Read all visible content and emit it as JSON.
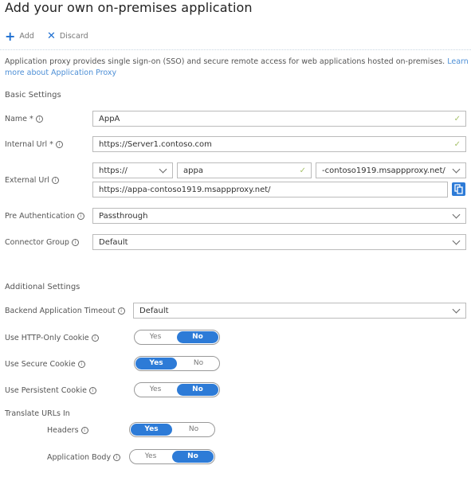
{
  "page": {
    "title": "Add your own on-premises application"
  },
  "toolbar": {
    "add_label": "Add",
    "discard_label": "Discard",
    "add_icon": "plus-icon",
    "discard_icon": "x-icon"
  },
  "description": {
    "text": "Application proxy provides single sign-on (SSO) and secure remote access for web applications hosted on-premises. ",
    "link_text": "Learn more about Application Proxy"
  },
  "basic_settings": {
    "heading": "Basic Settings",
    "name": {
      "label": "Name *",
      "value": "AppA",
      "valid": true
    },
    "internal_url": {
      "label": "Internal Url *",
      "value": "https://Server1.contoso.com",
      "valid": true
    },
    "external_url": {
      "label": "External Url",
      "scheme": "https://",
      "subdomain": "appa",
      "subdomain_valid": true,
      "domain": "-contoso1919.msappproxy.net/",
      "full_url": "https://appa-contoso1919.msappproxy.net/",
      "copy_icon": "copy-icon"
    },
    "pre_authentication": {
      "label": "Pre Authentication",
      "value": "Passthrough"
    },
    "connector_group": {
      "label": "Connector Group",
      "value": "Default"
    }
  },
  "additional_settings": {
    "heading": "Additional Settings",
    "backend_timeout": {
      "label": "Backend Application Timeout",
      "value": "Default"
    },
    "http_only_cookie": {
      "label": "Use HTTP-Only Cookie",
      "yes": "Yes",
      "no": "No",
      "selected": "No"
    },
    "secure_cookie": {
      "label": "Use Secure Cookie",
      "yes": "Yes",
      "no": "No",
      "selected": "Yes"
    },
    "persistent_cookie": {
      "label": "Use Persistent Cookie",
      "yes": "Yes",
      "no": "No",
      "selected": "No"
    },
    "translate_urls_heading": "Translate URLs In",
    "headers": {
      "label": "Headers",
      "yes": "Yes",
      "no": "No",
      "selected": "Yes"
    },
    "application_body": {
      "label": "Application Body",
      "yes": "Yes",
      "no": "No",
      "selected": "No"
    }
  },
  "colors": {
    "accent": "#2d7bd7",
    "valid_check": "#a7c26b",
    "link": "#4d8fd6"
  }
}
